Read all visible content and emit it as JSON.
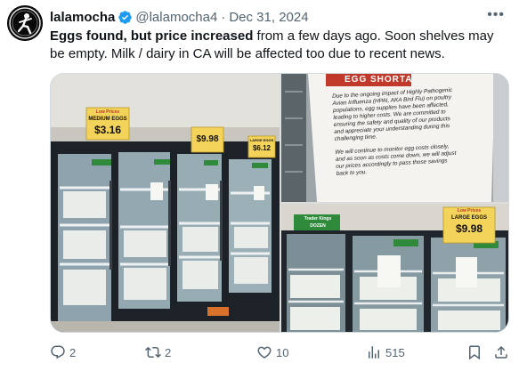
{
  "author": {
    "name": "lalamocha",
    "handle": "@lalamocha4",
    "separator": "·",
    "date": "Dec 31, 2024",
    "verified": true
  },
  "tweet": {
    "text_bold": "Eggs found, but price increased",
    "text_rest": " from a few days ago. Soon shelves may be empty. Milk / dairy in CA will be affected too due to recent news."
  },
  "media": {
    "left": {
      "sign1": {
        "top": "Low Prices",
        "mid": "MEDIUM EGGS",
        "price": "$3.16"
      },
      "sign2": {
        "price": "$9.98"
      },
      "sign3": {
        "top": "LARGE EGGS",
        "price": "$6.12"
      }
    },
    "top_right": {
      "heading": "EGG SHORTA",
      "paragraph1": [
        "Due to the ongoing impact of Highly Pathogenic",
        "Avian Influenza (HPAI, AKA Bird Flu) on poultry",
        "populations, egg supplies have been affected,",
        "leading to higher costs. We are committed to",
        "ensuring the safety and quality of our products",
        "and appreciate your understanding during this",
        "challenging time."
      ],
      "paragraph2": [
        "We will continue to monitor egg costs closely,",
        "and as soon as costs come down, we will adjust",
        "our prices accordingly to pass those savings",
        "back to you."
      ]
    },
    "bottom_right": {
      "store_sign_top": "Trader Kings",
      "store_sign_bottom": "DOZEN",
      "price_tag_top": "Low Prices",
      "price_tag_mid": "LARGE EGGS",
      "price_tag_price": "$9.98"
    }
  },
  "actions": {
    "replies": "2",
    "reposts": "2",
    "likes": "10",
    "views": "515"
  },
  "colors": {
    "text": "#0f1419",
    "secondary": "#536471",
    "verified": "#1d9bf0",
    "border": "#cfd9de"
  }
}
